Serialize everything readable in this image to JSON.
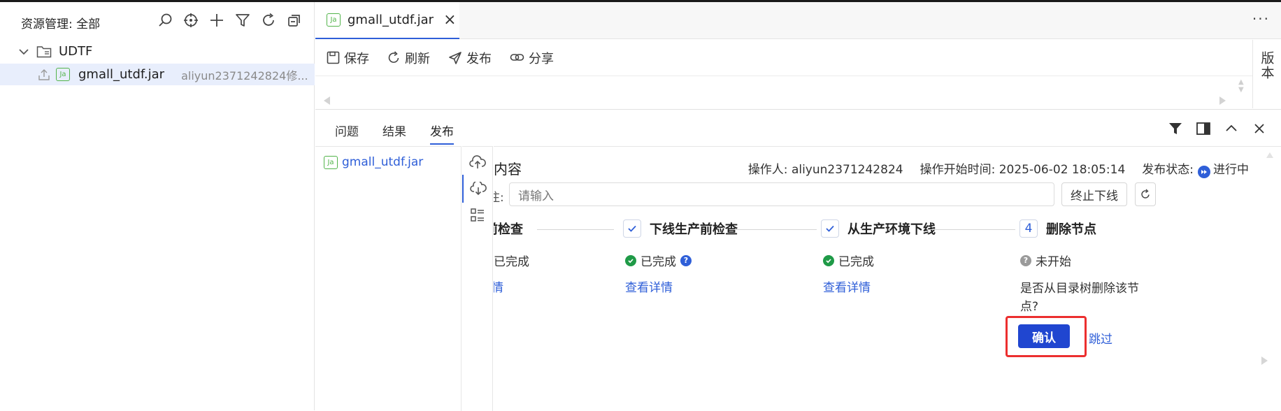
{
  "explorer": {
    "title": "资源管理: 全部",
    "folder": "UDTF",
    "file": {
      "badge": "Ja",
      "name": "gmall_utdf.jar",
      "meta": "aliyun2371242824修..."
    }
  },
  "editor": {
    "tab": {
      "badge": "Ja",
      "name": "gmall_utdf.jar",
      "close": "×"
    },
    "more": "···",
    "toolbar": {
      "save": "保存",
      "refresh": "刷新",
      "publish": "发布",
      "share": "分享"
    },
    "version_tab": "版本"
  },
  "panel": {
    "tabs": [
      "问题",
      "结果",
      "发布"
    ],
    "active_tab": "发布",
    "file": {
      "badge": "Ja",
      "name": "gmall_utdf.jar"
    },
    "title": "布内容",
    "operator": "操作人: aliyun2371242824",
    "start_time": "操作开始时间: 2025-06-02 18:05:14",
    "status_label": "发布状态:",
    "status_value": "进行中",
    "input_label": "注:",
    "input_placeholder": "请输入",
    "stop_button": "终止下线",
    "steps": [
      {
        "title": "下线前检查",
        "status": "已完成",
        "link": "查看详情"
      },
      {
        "title": "下线生产前检查",
        "status": "已完成",
        "link": "查看详情"
      },
      {
        "title": "从生产环境下线",
        "status": "已完成",
        "link": "查看详情"
      },
      {
        "index": "4",
        "title": "删除节点",
        "status": "未开始",
        "question": "是否从目录树删除该节点?"
      }
    ],
    "confirm": "确认",
    "skip": "跳过"
  },
  "colors": {
    "accent": "#2f5fd8",
    "primary_button": "#2046d0",
    "success": "#1f9a47",
    "highlight": "#ec2f2f",
    "jar_icon": "#52b44a"
  }
}
